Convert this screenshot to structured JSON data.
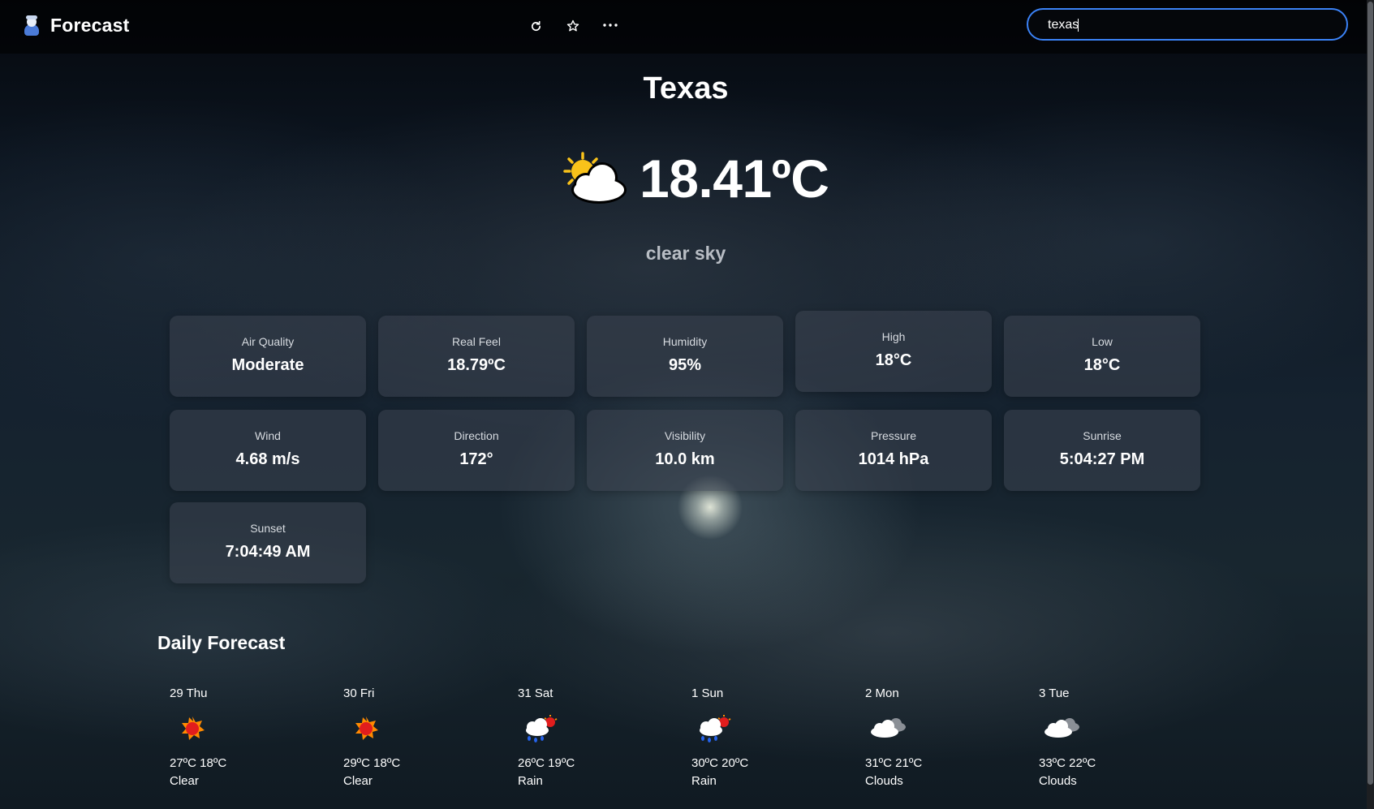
{
  "app": {
    "title": "Forecast",
    "logo_icon": "snowman-logo-icon"
  },
  "toolbar": {
    "refresh_icon": "⟳",
    "star_icon": "☆",
    "more_icon": "···"
  },
  "search": {
    "value": "texas",
    "accent": "#3b82f6"
  },
  "current": {
    "city": "Texas",
    "icon": "sun-behind-cloud-icon",
    "temperature": "18.41ºC",
    "description": "clear sky"
  },
  "details": [
    {
      "label": "Air Quality",
      "value": "Moderate"
    },
    {
      "label": "Real Feel",
      "value": "18.79ºC"
    },
    {
      "label": "Humidity",
      "value": "95%"
    },
    {
      "label": "High",
      "value": "18°C"
    },
    {
      "label": "Low",
      "value": "18°C"
    },
    {
      "label": "Wind",
      "value": "4.68 m/s"
    },
    {
      "label": "Direction",
      "value": "172°"
    },
    {
      "label": "Visibility",
      "value": "10.0 km"
    },
    {
      "label": "Pressure",
      "value": "1014 hPa"
    },
    {
      "label": "Sunrise",
      "value": "5:04:27 PM"
    },
    {
      "label": "Sunset",
      "value": "7:04:49 AM"
    }
  ],
  "daily": {
    "title": "Daily Forecast",
    "days": [
      {
        "date": "29 Thu",
        "icon": "sun-icon",
        "temps": "27ºC 18ºC",
        "condition": "Clear"
      },
      {
        "date": "30 Fri",
        "icon": "sun-icon",
        "temps": "29ºC 18ºC",
        "condition": "Clear"
      },
      {
        "date": "31 Sat",
        "icon": "rain-cloud-icon",
        "temps": "26ºC 19ºC",
        "condition": "Rain"
      },
      {
        "date": "1 Sun",
        "icon": "rain-cloud-icon",
        "temps": "30ºC 20ºC",
        "condition": "Rain"
      },
      {
        "date": "2 Mon",
        "icon": "cloud-icon",
        "temps": "31ºC 21ºC",
        "condition": "Clouds"
      },
      {
        "date": "3 Tue",
        "icon": "cloud-icon",
        "temps": "33ºC 22ºC",
        "condition": "Clouds"
      }
    ]
  }
}
